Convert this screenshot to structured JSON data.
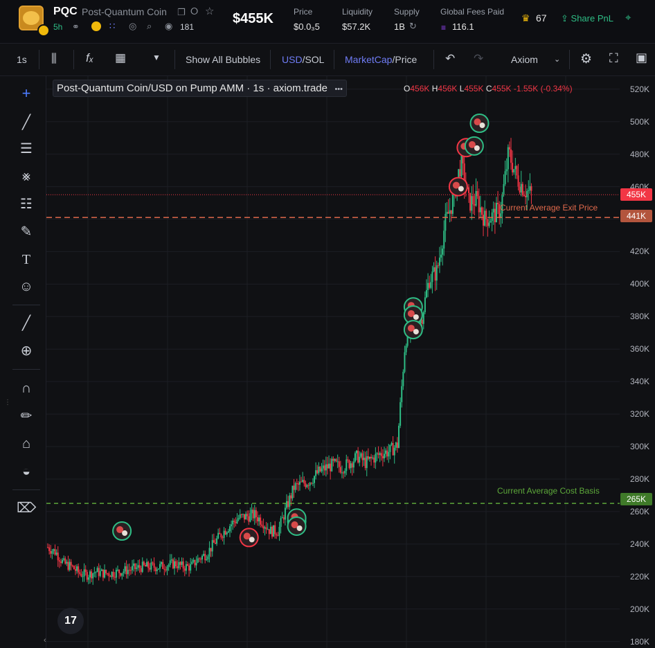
{
  "header": {
    "ticker": "PQC",
    "token_name": "Post-Quantum Coin",
    "age": "5h",
    "holders": "181",
    "market_cap": "$455K",
    "stats": [
      {
        "label": "Price",
        "value": "$0.0₃5"
      },
      {
        "label": "Liquidity",
        "value": "$57.2K"
      },
      {
        "label": "Supply",
        "value": "1B"
      },
      {
        "label": "Global Fees Paid",
        "value": "116.1"
      }
    ],
    "crown_count": "67",
    "share_label": "Share PnL"
  },
  "toolbar": {
    "interval": "1s",
    "show_bubbles": "Show All Bubbles",
    "currency_a": "USD",
    "currency_b": "SOL",
    "mode_a": "MarketCap",
    "mode_b": "Price",
    "source": "Axiom"
  },
  "legend": {
    "title": "Post-Quantum Coin/USD on Pump AMM · 1s · axiom.trade",
    "dots": "•••",
    "o_label": "O",
    "o": "456K",
    "h_label": "H",
    "h": "456K",
    "l_label": "L",
    "l": "455K",
    "c_label": "C",
    "c": "455K",
    "change": "-1.55K (-0.34%)"
  },
  "lines": {
    "exit_label": "Current Average Exit Price",
    "cost_label": "Current Average Cost Basis",
    "current_tag": "455K",
    "exit_tag": "441K",
    "cost_tag": "265K"
  },
  "axis_ticks": [
    "520K",
    "500K",
    "480K",
    "460K",
    "440K",
    "420K",
    "400K",
    "380K",
    "360K",
    "340K",
    "320K",
    "300K",
    "280K",
    "260K",
    "240K",
    "220K",
    "200K",
    "180K"
  ],
  "tv_logo": "17",
  "colors": {
    "up": "#2ebd85",
    "down": "#f23645",
    "exit": "#e0694b",
    "cost": "#5da83a",
    "current": "#f23645"
  },
  "chart_data": {
    "type": "candlestick",
    "ylabel": "MarketCap (USD)",
    "ylim": [
      176000,
      528000
    ],
    "series_path": [
      [
        0,
        238000
      ],
      [
        3,
        235000
      ],
      [
        6,
        228000
      ],
      [
        9,
        226000
      ],
      [
        12,
        222000
      ],
      [
        15,
        221000
      ],
      [
        18,
        223000
      ],
      [
        21,
        222000
      ],
      [
        24,
        222000
      ],
      [
        27,
        223000
      ],
      [
        30,
        224000
      ],
      [
        33,
        225000
      ],
      [
        36,
        226000
      ],
      [
        39,
        226000
      ],
      [
        42,
        226000
      ],
      [
        45,
        227000
      ],
      [
        48,
        228000
      ],
      [
        51,
        226000
      ],
      [
        54,
        226000
      ],
      [
        57,
        231000
      ],
      [
        60,
        234000
      ],
      [
        63,
        241000
      ],
      [
        66,
        247000
      ],
      [
        69,
        252000
      ],
      [
        72,
        256000
      ],
      [
        75,
        257000
      ],
      [
        78,
        258000
      ],
      [
        81,
        254000
      ],
      [
        84,
        248000
      ],
      [
        87,
        248000
      ],
      [
        90,
        262000
      ],
      [
        93,
        275000
      ],
      [
        96,
        277000
      ],
      [
        99,
        279000
      ],
      [
        102,
        284000
      ],
      [
        105,
        287000
      ],
      [
        108,
        289000
      ],
      [
        111,
        287000
      ],
      [
        114,
        290000
      ],
      [
        117,
        294000
      ],
      [
        120,
        290000
      ],
      [
        123,
        293000
      ],
      [
        126,
        296000
      ],
      [
        129,
        297000
      ],
      [
        132,
        301000
      ],
      [
        135,
        366000
      ],
      [
        138,
        376000
      ],
      [
        141,
        378000
      ],
      [
        144,
        403000
      ],
      [
        147,
        408000
      ],
      [
        150,
        437000
      ],
      [
        153,
        452000
      ],
      [
        156,
        475000
      ],
      [
        159,
        450000
      ],
      [
        162,
        452000
      ],
      [
        165,
        440000
      ],
      [
        168,
        442000
      ],
      [
        171,
        446000
      ],
      [
        174,
        481000
      ],
      [
        177,
        466000
      ],
      [
        180,
        458000
      ],
      [
        183,
        455000
      ]
    ],
    "bubbles": [
      {
        "x": 28,
        "y": 248000,
        "kind": "buy"
      },
      {
        "x": 76,
        "y": 244000,
        "kind": "sell"
      },
      {
        "x": 94,
        "y": 254000,
        "kind": "buy"
      },
      {
        "x": 94,
        "y": 256000,
        "kind": "buy"
      },
      {
        "x": 94,
        "y": 251000,
        "kind": "buy"
      },
      {
        "x": 138,
        "y": 386000,
        "kind": "buy"
      },
      {
        "x": 138,
        "y": 381000,
        "kind": "buy"
      },
      {
        "x": 138,
        "y": 372000,
        "kind": "buy"
      },
      {
        "x": 155,
        "y": 460000,
        "kind": "sell"
      },
      {
        "x": 158,
        "y": 484000,
        "kind": "sell"
      },
      {
        "x": 161,
        "y": 485000,
        "kind": "buy"
      },
      {
        "x": 163,
        "y": 499000,
        "kind": "buy"
      }
    ],
    "hlines": [
      {
        "name": "Current Average Exit Price",
        "value": 441000
      },
      {
        "name": "Current Average Cost Basis",
        "value": 265000
      },
      {
        "name": "last",
        "value": 455000
      }
    ]
  }
}
